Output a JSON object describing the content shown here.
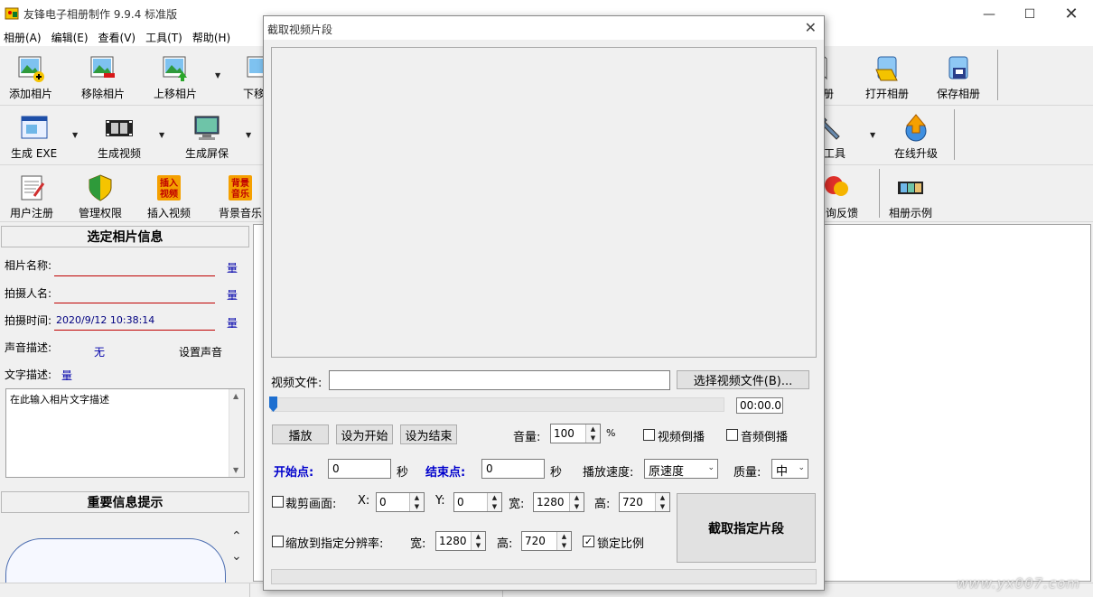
{
  "window": {
    "title": "友锋电子相册制作 9.9.4 标准版"
  },
  "menu": [
    "相册(A)",
    "编辑(E)",
    "查看(V)",
    "工具(T)",
    "帮助(H)"
  ],
  "toolbar1": {
    "add_photo": "添加相片",
    "remove_photo": "移除相片",
    "move_up": "上移相片",
    "move_down": "下移",
    "partial": "册",
    "open_album": "打开相册",
    "save_album": "保存相册"
  },
  "toolbar2": {
    "gen_exe": "生成 EXE",
    "gen_video": "生成视频",
    "gen_screensaver": "生成屏保",
    "partial": "关工具",
    "online_upgrade": "在线升级"
  },
  "toolbar3": {
    "user_register": "用户注册",
    "manage_rights": "管理权限",
    "insert_video": "插入视频",
    "bg_music": "背景音乐",
    "partial": "咨询反馈",
    "album_examples": "相册示例"
  },
  "photo_info": {
    "header": "选定相片信息",
    "name_label": "相片名称:",
    "photographer_label": "拍摄人名:",
    "time_label": "拍摄时间:",
    "time_value": "2020/9/12 10:38:14",
    "sound_label": "声音描述:",
    "sound_value": "无",
    "set_sound": "设置声音",
    "text_label": "文字描述:",
    "link": "量",
    "desc_placeholder": "在此输入相片文字描述"
  },
  "important_info": {
    "header": "重要信息提示"
  },
  "dialog": {
    "title": "截取视频片段",
    "video_file_label": "视频文件:",
    "video_file_value": "",
    "choose_file_btn": "选择视频文件(B)...",
    "time_display": "00:00.0",
    "play_btn": "播放",
    "set_start_btn": "设为开始",
    "set_end_btn": "设为结束",
    "volume_label": "音量:",
    "volume_value": "100",
    "volume_unit": "%",
    "video_reverse": "视频倒播",
    "audio_reverse": "音频倒播",
    "start_label": "开始点:",
    "start_value": "0",
    "sec1": "秒",
    "end_label": "结束点:",
    "end_value": "0",
    "sec2": "秒",
    "speed_label": "播放速度:",
    "speed_value": "原速度",
    "quality_label": "质量:",
    "quality_value": "中",
    "crop_label": "裁剪画面:",
    "x_label": "X:",
    "x_value": "0",
    "y_label": "Y:",
    "y_value": "0",
    "crop_w_label": "宽:",
    "crop_w_value": "1280",
    "crop_h_label": "高:",
    "crop_h_value": "720",
    "scale_label": "缩放到指定分辨率:",
    "scale_w_label": "宽:",
    "scale_w_value": "1280",
    "scale_h_label": "高:",
    "scale_h_value": "720",
    "lock_ratio": "锁定比例",
    "lock_ratio_checked": true,
    "capture_btn": "截取指定片段"
  },
  "watermark": "www.yx007.com"
}
